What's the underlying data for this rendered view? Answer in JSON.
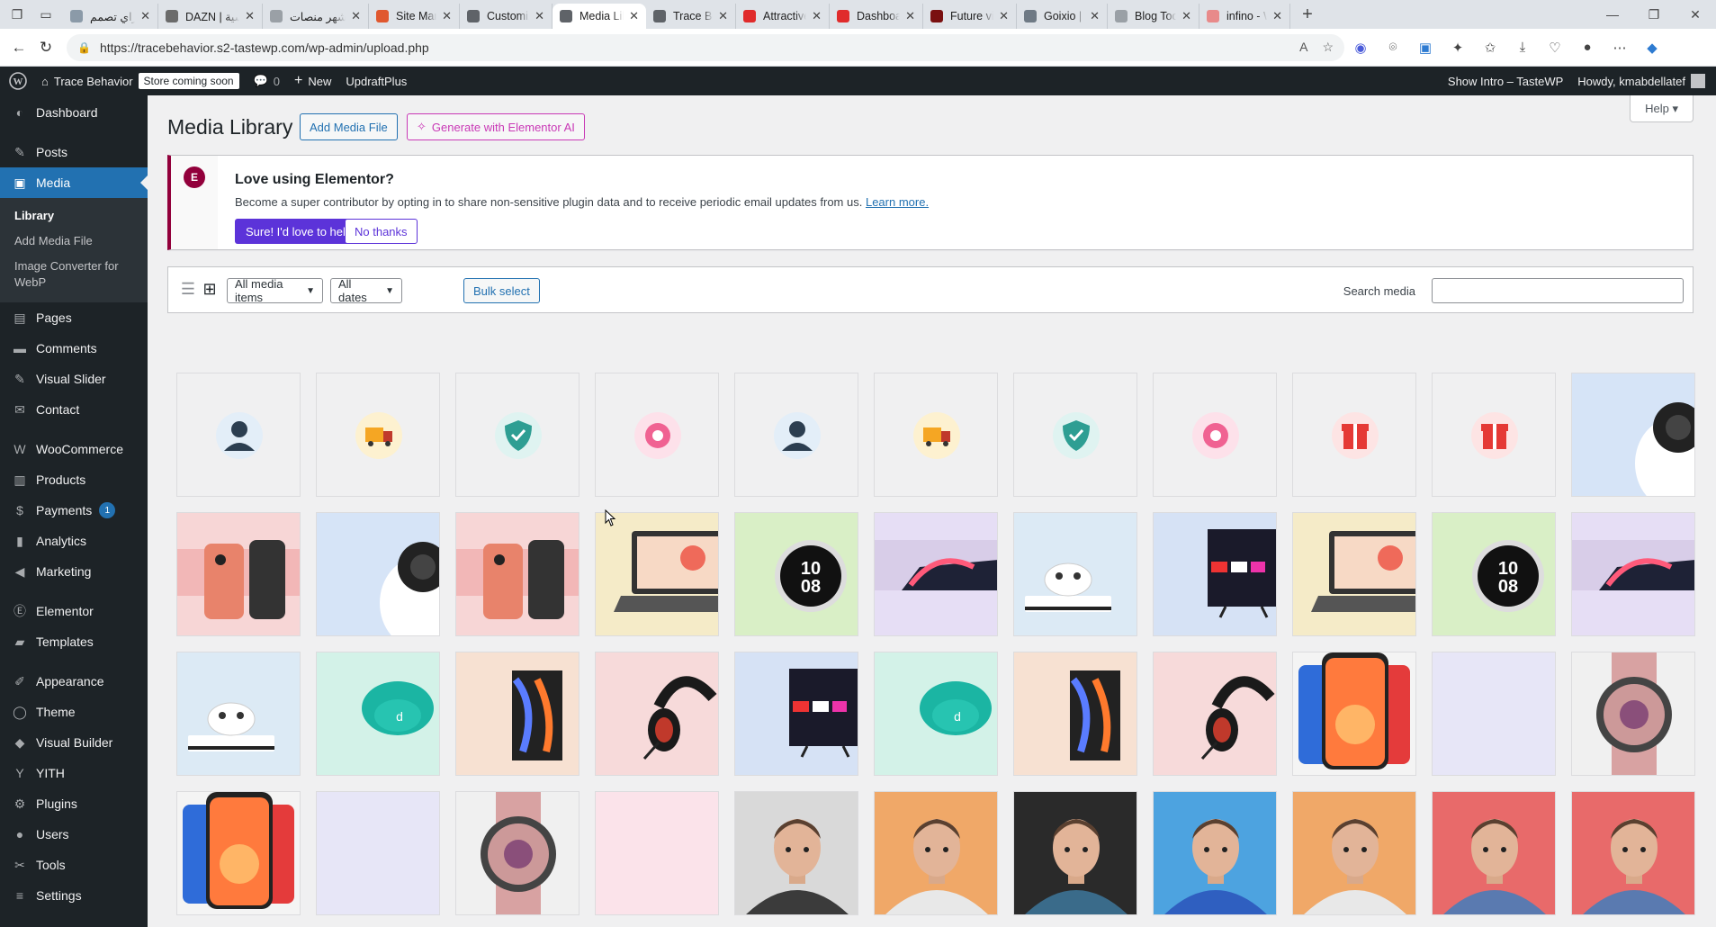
{
  "browser": {
    "tabs": [
      {
        "title": "ازاي تصمم",
        "color": "#8b9aa8",
        "active": false
      },
      {
        "title": "DAZN | سية",
        "color": "#6b6b6b",
        "active": false
      },
      {
        "title": "اشهر منصات",
        "color": "#9aa0a6",
        "active": false
      },
      {
        "title": "Site Manag",
        "color": "#e0582f",
        "active": false
      },
      {
        "title": "Customize:",
        "color": "#5f6368",
        "active": false
      },
      {
        "title": "Media Libra",
        "color": "#5f6368",
        "active": true
      },
      {
        "title": "Trace Behav",
        "color": "#5f6368",
        "active": false
      },
      {
        "title": "Attractive R",
        "color": "#e02b2b",
        "active": false
      },
      {
        "title": "Dashboard",
        "color": "#e02b2b",
        "active": false
      },
      {
        "title": "Future visio",
        "color": "#7a1010",
        "active": false
      },
      {
        "title": "Goixio | Do",
        "color": "#6f7a85",
        "active": false
      },
      {
        "title": "Blog Tool, P",
        "color": "#9aa0a6",
        "active": false
      },
      {
        "title": "infino - Wo",
        "color": "#e88a8a",
        "active": false
      }
    ],
    "url": "https://tracebehavior.s2-tastewp.com/wp-admin/upload.php"
  },
  "adminbar": {
    "site_name": "Trace Behavior",
    "store_badge": "Store coming soon",
    "comments_count": "0",
    "new_label": "New",
    "updraft": "UpdraftPlus",
    "show_intro": "Show Intro – TasteWP",
    "howdy": "Howdy, kmabdellatef"
  },
  "sidebar": {
    "items": [
      {
        "label": "Dashboard",
        "icon": "dashboard-icon"
      },
      {
        "label": "Posts",
        "icon": "pin-icon"
      },
      {
        "label": "Media",
        "icon": "media-icon"
      },
      {
        "label": "Pages",
        "icon": "pages-icon"
      },
      {
        "label": "Comments",
        "icon": "comments-icon"
      },
      {
        "label": "Visual Slider",
        "icon": "pin-icon"
      },
      {
        "label": "Contact",
        "icon": "mail-icon"
      },
      {
        "label": "WooCommerce",
        "icon": "woo-icon"
      },
      {
        "label": "Products",
        "icon": "archive-icon"
      },
      {
        "label": "Payments",
        "icon": "dollar-icon",
        "count": "1"
      },
      {
        "label": "Analytics",
        "icon": "bar-chart-icon"
      },
      {
        "label": "Marketing",
        "icon": "megaphone-icon"
      },
      {
        "label": "Elementor",
        "icon": "elementor-icon"
      },
      {
        "label": "Templates",
        "icon": "folder-icon"
      },
      {
        "label": "Appearance",
        "icon": "brush-icon"
      },
      {
        "label": "Theme",
        "icon": "circle-icon"
      },
      {
        "label": "Visual Builder",
        "icon": "divi-icon"
      },
      {
        "label": "YITH",
        "icon": "yith-icon"
      },
      {
        "label": "Plugins",
        "icon": "plugin-icon"
      },
      {
        "label": "Users",
        "icon": "user-icon"
      },
      {
        "label": "Tools",
        "icon": "wrench-icon"
      },
      {
        "label": "Settings",
        "icon": "settings-icon"
      }
    ],
    "media_sub": [
      "Library",
      "Add Media File",
      "Image Converter for WebP"
    ]
  },
  "main": {
    "title": "Media Library",
    "add_button": "Add Media File",
    "ai_button": "Generate with Elementor AI",
    "help": "Help"
  },
  "notice": {
    "title": "Love using Elementor?",
    "text": "Become a super contributor by opting in to share non-sensitive plugin data and to receive periodic email updates from us.",
    "link": "Learn more.",
    "yes": "Sure! I'd love to help",
    "no": "No thanks"
  },
  "toolbar": {
    "filter_type": "All media items",
    "filter_date": "All dates",
    "bulk": "Bulk select",
    "search_label": "Search media",
    "search_value": ""
  },
  "media_items": [
    {
      "kind": "user-icon",
      "bg": "#f0f0f1",
      "accent": "#2c3e50"
    },
    {
      "kind": "truck-icon",
      "bg": "#f0f0f1",
      "accent": "#f5a623"
    },
    {
      "kind": "shield-icon",
      "bg": "#f0f0f1",
      "accent": "#2e9e93"
    },
    {
      "kind": "pink-circle-icon",
      "bg": "#f0f0f1",
      "accent": "#f06292"
    },
    {
      "kind": "user-icon",
      "bg": "#f0f0f1",
      "accent": "#2c3e50"
    },
    {
      "kind": "truck-icon",
      "bg": "#f0f0f1",
      "accent": "#f5a623"
    },
    {
      "kind": "shield-icon",
      "bg": "#f0f0f1",
      "accent": "#2e9e93"
    },
    {
      "kind": "pink-circle-icon",
      "bg": "#f0f0f1",
      "accent": "#f06292"
    },
    {
      "kind": "gift-icon",
      "bg": "#f0f0f1",
      "accent": "#e53935"
    },
    {
      "kind": "gift-icon",
      "bg": "#f0f0f1",
      "accent": "#e53935"
    },
    {
      "kind": "camera-photo",
      "bg": "#d6e4f7",
      "accent": "#ffffff"
    },
    {
      "kind": "phone-photo",
      "bg": "#f7d6d6",
      "accent": "#e8836b"
    },
    {
      "kind": "camera-photo",
      "bg": "#d6e4f7",
      "accent": "#ffffff"
    },
    {
      "kind": "phone-photo",
      "bg": "#f7d6d6",
      "accent": "#e8836b"
    },
    {
      "kind": "laptop-photo",
      "bg": "#f5ebc8",
      "accent": "#ef6a5a"
    },
    {
      "kind": "watch-photo",
      "bg": "#d9efc6",
      "accent": "#111111"
    },
    {
      "kind": "iphone-dark-photo",
      "bg": "#e6def5",
      "accent": "#1e2236"
    },
    {
      "kind": "xbox-photo",
      "bg": "#dceaf5",
      "accent": "#ffffff"
    },
    {
      "kind": "tv-photo",
      "bg": "#d6e2f5",
      "accent": "#1a1a2a"
    },
    {
      "kind": "laptop-photo",
      "bg": "#f5ebc8",
      "accent": "#ef6a5a"
    },
    {
      "kind": "watch-photo",
      "bg": "#d9efc6",
      "accent": "#111111"
    },
    {
      "kind": "iphone-dark-photo",
      "bg": "#e6def5",
      "accent": "#1e2236"
    },
    {
      "kind": "xbox-photo",
      "bg": "#dceaf5",
      "accent": "#ffffff"
    },
    {
      "kind": "earbuds-photo",
      "bg": "#d3f2e8",
      "accent": "#1bb5a3"
    },
    {
      "kind": "fold-phone-photo",
      "bg": "#f7e1d2",
      "accent": "#222222"
    },
    {
      "kind": "headset-photo",
      "bg": "#f7dada",
      "accent": "#1a1a1a"
    },
    {
      "kind": "tv-photo",
      "bg": "#d6e2f5",
      "accent": "#1a1a2a"
    },
    {
      "kind": "earbuds-photo",
      "bg": "#d3f2e8",
      "accent": "#1bb5a3"
    },
    {
      "kind": "fold-phone-photo",
      "bg": "#f7e1d2",
      "accent": "#222222"
    },
    {
      "kind": "headset-photo",
      "bg": "#f7dada",
      "accent": "#1a1a1a"
    },
    {
      "kind": "iphone-color-photo",
      "bg": "#f4f4f4",
      "accent": "#ff7a3d"
    },
    {
      "kind": "blank-photo",
      "bg": "#e7e6f7",
      "accent": "#e7e6f7"
    },
    {
      "kind": "smartwatch-photo",
      "bg": "#f0f0f0",
      "accent": "#d8a2a2"
    },
    {
      "kind": "iphone-color-photo",
      "bg": "#f4f4f4",
      "accent": "#ff7a3d"
    },
    {
      "kind": "blank-photo",
      "bg": "#e7e6f7",
      "accent": "#e7e6f7"
    },
    {
      "kind": "smartwatch-photo",
      "bg": "#f0f0f0",
      "accent": "#d8a2a2"
    },
    {
      "kind": "blank-photo",
      "bg": "#fbe3ea",
      "accent": "#fbe3ea"
    },
    {
      "kind": "man-photo",
      "bg": "#d9d9d9",
      "accent": "#3b3b3b"
    },
    {
      "kind": "man-photo",
      "bg": "#f0a868",
      "accent": "#e8e8e8"
    },
    {
      "kind": "man-photo",
      "bg": "#2a2a2a",
      "accent": "#3a6b8a"
    },
    {
      "kind": "man-photo",
      "bg": "#4da3e0",
      "accent": "#2f5fc0"
    },
    {
      "kind": "man-photo",
      "bg": "#f0a868",
      "accent": "#e8e8e8"
    },
    {
      "kind": "man-photo",
      "bg": "#e86a6a",
      "accent": "#5a7ab0"
    },
    {
      "kind": "man-photo",
      "bg": "#e86a6a",
      "accent": "#5a7ab0"
    }
  ]
}
